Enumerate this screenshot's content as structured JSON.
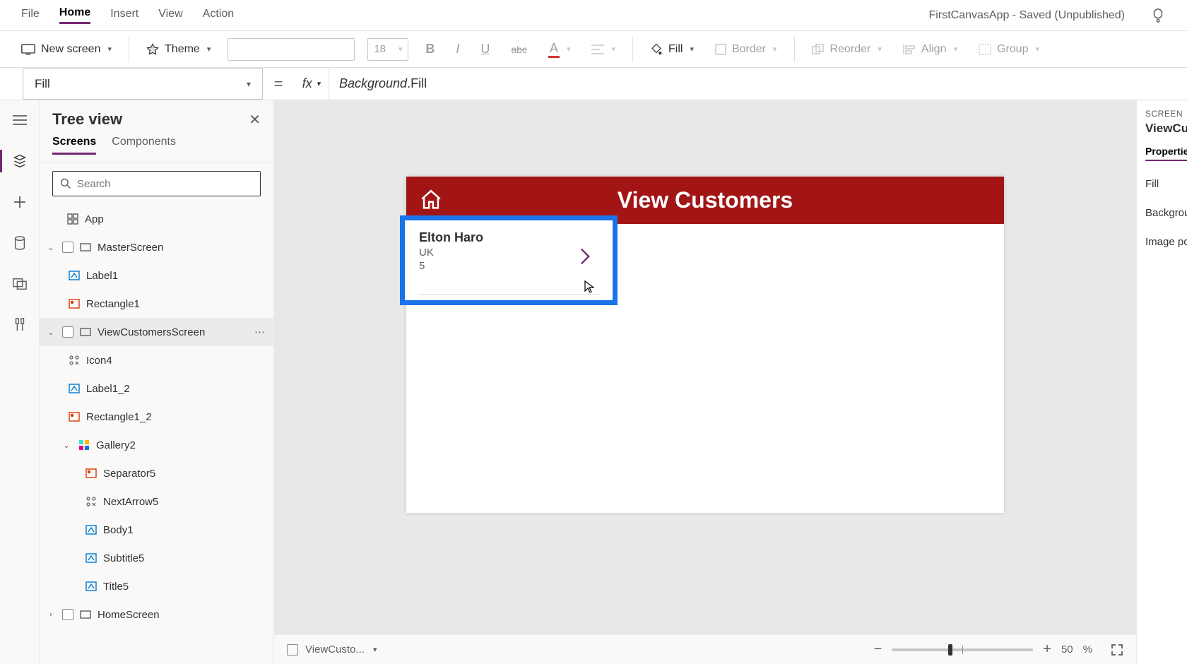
{
  "menubar": {
    "items": [
      "File",
      "Home",
      "Insert",
      "View",
      "Action"
    ],
    "active": "Home"
  },
  "appTitle": "FirstCanvasApp - Saved (Unpublished)",
  "ribbon": {
    "newScreen": "New screen",
    "theme": "Theme",
    "fontSize": "18",
    "fill": "Fill",
    "border": "Border",
    "reorder": "Reorder",
    "align": "Align",
    "group": "Group"
  },
  "formulaBar": {
    "propertySelector": "Fill",
    "fx": "fx",
    "formulaPart1": "Background",
    "formulaPart2": ".Fill"
  },
  "treeView": {
    "title": "Tree view",
    "tabs": {
      "screens": "Screens",
      "components": "Components"
    },
    "searchPlaceholder": "Search",
    "nodes": {
      "app": "App",
      "master": "MasterScreen",
      "label1": "Label1",
      "rect1": "Rectangle1",
      "viewCust": "ViewCustomersScreen",
      "icon4": "Icon4",
      "label12": "Label1_2",
      "rect12": "Rectangle1_2",
      "gallery2": "Gallery2",
      "sep5": "Separator5",
      "next5": "NextArrow5",
      "body1": "Body1",
      "subtitle5": "Subtitle5",
      "title5": "Title5",
      "home": "HomeScreen"
    }
  },
  "canvas": {
    "headerTitle": "View Customers",
    "gallery": {
      "title": "Elton  Haro",
      "subtitle": "UK",
      "body": "5"
    }
  },
  "canvasFooter": {
    "selected": "ViewCusto...",
    "zoomPct": "50",
    "pctSym": "%"
  },
  "propPanel": {
    "typeLabel": "SCREEN",
    "name": "ViewCusto",
    "tab": "Properties",
    "rows": [
      "Fill",
      "Background",
      "Image posit"
    ]
  }
}
